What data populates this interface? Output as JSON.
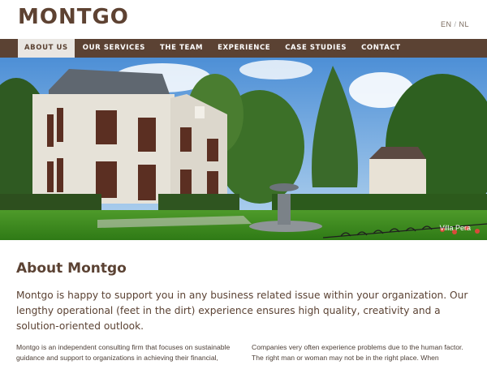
{
  "header": {
    "logo": "MONTGO",
    "languages": [
      "EN",
      "NL"
    ]
  },
  "nav": {
    "items": [
      "ABOUT US",
      "OUR SERVICES",
      "THE TEAM",
      "EXPERIENCE",
      "CASE STUDIES",
      "CONTACT"
    ],
    "active": "ABOUT US"
  },
  "hero": {
    "caption": "Villa Pera"
  },
  "main": {
    "title": "About Montgo",
    "intro": "Montgo is happy to support you in any business related issue within your organization. Our lengthy operational (feet in the dirt) experience ensures high quality, creativity and a solution-oriented outlook.",
    "col_left": "Montgo is an independent consulting firm that focuses on sustainable guidance and support to organizations in achieving their financial,",
    "col_right": "Companies very often experience problems due to the human factor. The right man or woman may not be in the right place. When"
  },
  "colors": {
    "brand": "#5b4233",
    "nav_active_bg": "#e9e6e2"
  }
}
